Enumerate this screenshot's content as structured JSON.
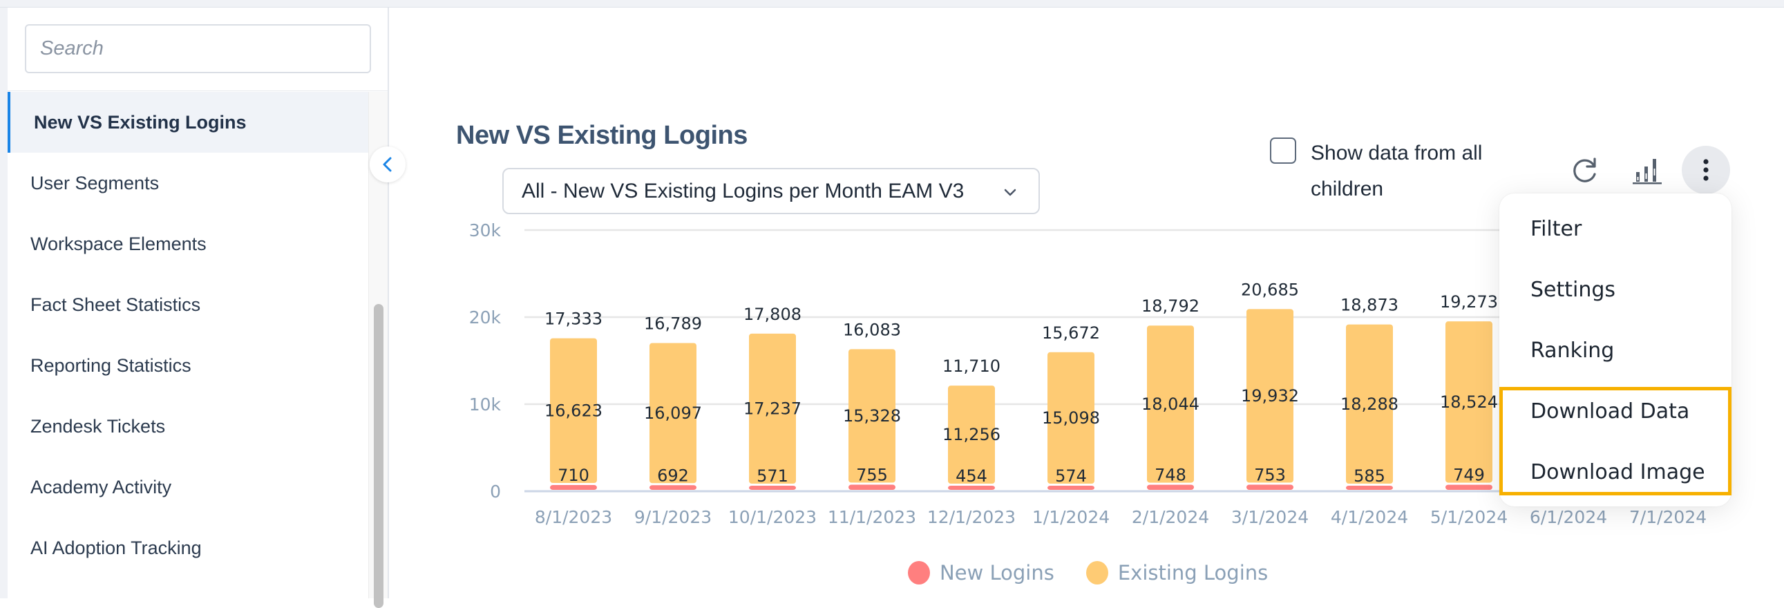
{
  "sidebar": {
    "search_placeholder": "Search",
    "search_value": "",
    "items": [
      {
        "label": "New VS Existing Logins",
        "active": true
      },
      {
        "label": "User Segments",
        "active": false
      },
      {
        "label": "Workspace Elements",
        "active": false
      },
      {
        "label": "Fact Sheet Statistics",
        "active": false
      },
      {
        "label": "Reporting Statistics",
        "active": false
      },
      {
        "label": "Zendesk Tickets",
        "active": false
      },
      {
        "label": "Academy Activity",
        "active": false
      },
      {
        "label": "AI Adoption Tracking",
        "active": false
      }
    ],
    "collapse_icon": "chevron-left-icon"
  },
  "main": {
    "title": "New VS Existing Logins",
    "report_select": {
      "value": "All - New VS Existing Logins per Month EAM V3"
    },
    "show_children": {
      "label": "Show data from all children",
      "checked": false
    },
    "toolbar": {
      "refresh_icon": "refresh-icon",
      "chart_type_icon": "stacked-bar-chart-icon",
      "more_icon": "kebab-menu-icon"
    }
  },
  "menu": {
    "items": [
      {
        "label": "Filter",
        "highlighted": false
      },
      {
        "label": "Settings",
        "highlighted": false
      },
      {
        "label": "Ranking",
        "highlighted": false
      },
      {
        "label": "Download Data",
        "highlighted": true
      },
      {
        "label": "Download Image",
        "highlighted": true
      }
    ],
    "highlight_color": "#f7b000"
  },
  "colors": {
    "new_logins": "#ff7f7f",
    "existing_logins": "#fecb74",
    "accent": "#1a84e6"
  },
  "chart_data": {
    "type": "bar",
    "stacked": true,
    "title": "New VS Existing Logins",
    "xlabel": "",
    "ylabel": "",
    "ylim": [
      0,
      30000
    ],
    "yticks": [
      0,
      10000,
      20000,
      30000
    ],
    "ytick_labels": [
      "0",
      "10k",
      "20k",
      "30k"
    ],
    "grid": true,
    "legend": "bottom-center",
    "categories": [
      "8/1/2023",
      "9/1/2023",
      "10/1/2023",
      "11/1/2023",
      "12/1/2023",
      "1/1/2024",
      "2/1/2024",
      "3/1/2024",
      "4/1/2024",
      "5/1/2024",
      "6/1/2024",
      "7/1/2024"
    ],
    "series": [
      {
        "name": "New Logins",
        "color": "#ff7f7f",
        "values": [
          710,
          692,
          571,
          755,
          454,
          574,
          748,
          753,
          585,
          749,
          null,
          null
        ]
      },
      {
        "name": "Existing Logins",
        "color": "#fecb74",
        "values": [
          16623,
          16097,
          17237,
          15328,
          11256,
          15098,
          18044,
          19932,
          18288,
          18524,
          null,
          null
        ]
      }
    ],
    "totals": [
      17333,
      16789,
      17808,
      16083,
      11710,
      15672,
      18792,
      20685,
      18873,
      19273,
      null,
      null
    ],
    "value_labels": {
      "new": [
        "710",
        "692",
        "571",
        "755",
        "454",
        "574",
        "748",
        "753",
        "585",
        "749",
        null,
        null
      ],
      "existing": [
        "16,623",
        "16,097",
        "17,237",
        "15,328",
        "11,256",
        "15,098",
        "18,044",
        "19,932",
        "18,288",
        "18,524",
        null,
        null
      ],
      "total": [
        "17,333",
        "16,789",
        "17,808",
        "16,083",
        "11,710",
        "15,672",
        "18,792",
        "20,685",
        "18,873",
        "19,273",
        null,
        null
      ]
    }
  }
}
